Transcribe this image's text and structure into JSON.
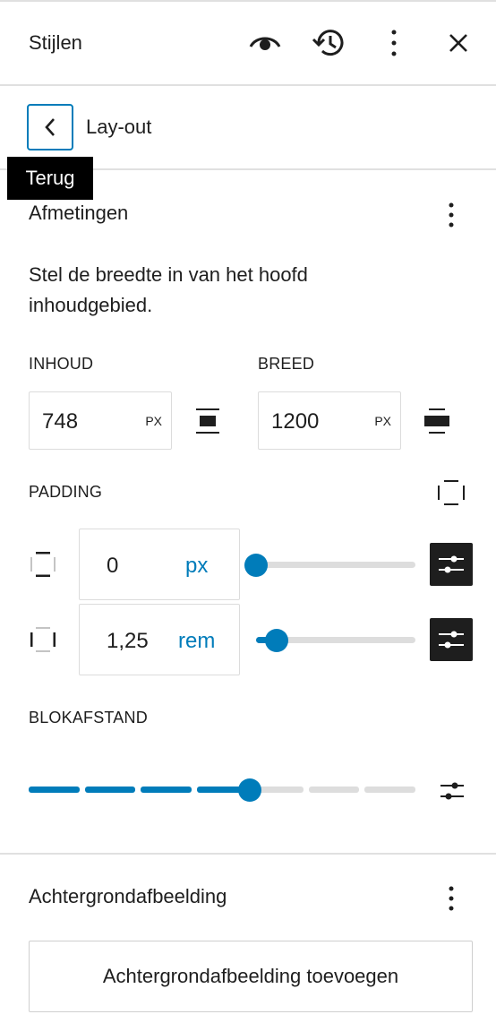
{
  "header": {
    "title": "Stijlen",
    "icons": [
      "eye-icon",
      "history-icon",
      "more-vertical-icon",
      "close-icon"
    ]
  },
  "nav": {
    "title": "Lay-out",
    "back_tooltip": "Terug"
  },
  "dimensions": {
    "title": "Afmetingen",
    "description_line1": "Stel de breedte in van het hoofd",
    "description_line2": "inhoudgebied.",
    "content": {
      "label": "INHOUD",
      "value": "748",
      "unit": "PX"
    },
    "wide": {
      "label": "BREED",
      "value": "1200",
      "unit": "PX"
    },
    "padding": {
      "label": "PADDING",
      "vertical": {
        "value": "0",
        "unit": "px",
        "slider_fraction": 0.0
      },
      "horizontal": {
        "value": "1,25",
        "unit": "rem",
        "slider_fraction": 0.13
      }
    },
    "block_spacing": {
      "label": "BLOKAFSTAND",
      "selected_step": 4,
      "total_steps": 7
    }
  },
  "background": {
    "title": "Achtergrondafbeelding",
    "add_label": "Achtergrondafbeelding toevoegen"
  },
  "colors": {
    "accent": "#007cba",
    "dark": "#1e1e1e",
    "track": "#dddddd",
    "divider": "#e0e0e0"
  }
}
